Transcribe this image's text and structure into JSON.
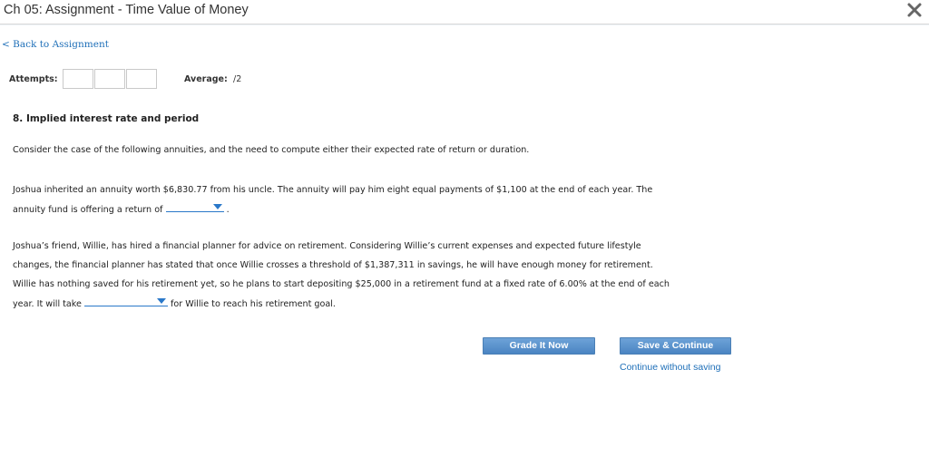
{
  "window": {
    "title": "Ch 05: Assignment - Time Value of Money",
    "close_icon": "close-icon"
  },
  "nav": {
    "back_link": "< Back to Assignment"
  },
  "attempts": {
    "label": "Attempts:",
    "boxes": [
      "",
      "",
      ""
    ],
    "average_label": "Average:",
    "average_value": "/2"
  },
  "question": {
    "title": "8. Implied interest rate and period",
    "intro": "Consider the case of the following annuities, and the need to compute either their expected rate of return or duration.",
    "p1": {
      "line1": "Joshua inherited an annuity worth $6,830.77 from his uncle. The annuity will pay him eight equal payments of $1,100 at the end of each year. The",
      "line2_before": "annuity fund is offering a return of",
      "dropdown_value": "",
      "line2_after": "."
    },
    "p2": {
      "line1": "Joshua’s friend, Willie, has hired a financial planner for advice on retirement. Considering Willie’s current expenses and expected future lifestyle",
      "line2": "changes, the financial planner has stated that once Willie crosses a threshold of $1,387,311 in savings, he will have enough money for retirement.",
      "line3": "Willie has nothing saved for his retirement yet, so he plans to start depositing $25,000 in a retirement fund at a fixed rate of 6.00% at the end of each",
      "line4_before": "year. It will take",
      "dropdown_value": "",
      "line4_after": "for Willie to reach his retirement goal."
    }
  },
  "actions": {
    "grade_label": "Grade It Now",
    "save_label": "Save & Continue",
    "continue_link": "Continue without saving"
  },
  "colors": {
    "accent": "#4a84c2",
    "link": "#1e6fb8"
  }
}
